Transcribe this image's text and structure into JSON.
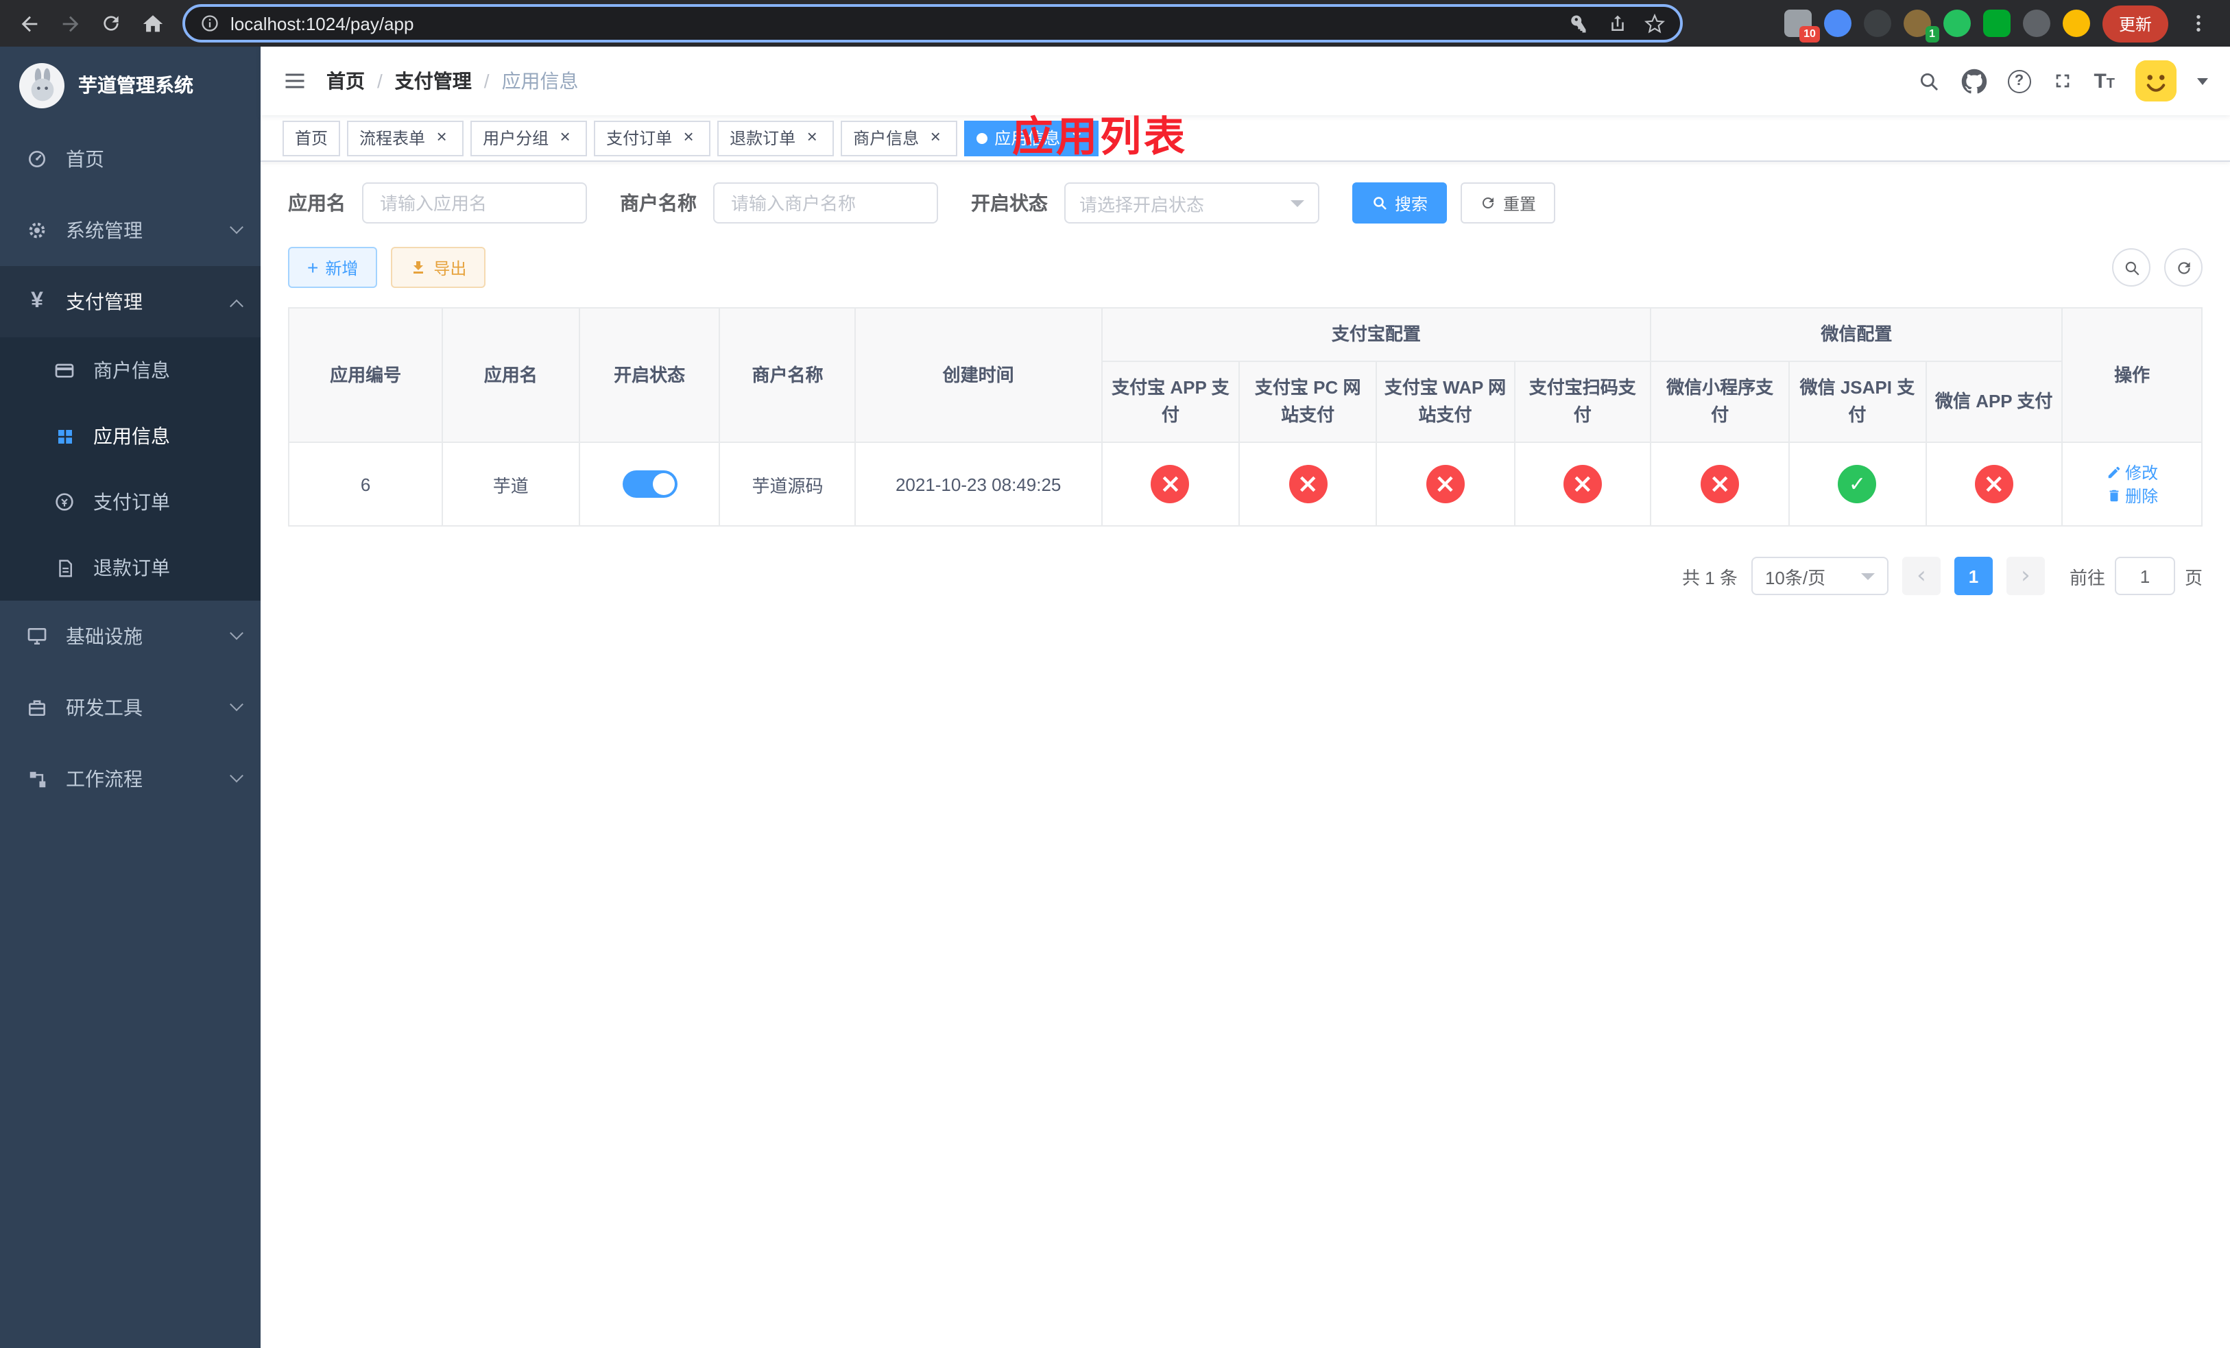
{
  "browser": {
    "url": "localhost:1024/pay/app",
    "update_button": "更新",
    "extensions": [
      {
        "name": "extensions-grid-icon",
        "color": "#9aa0a6",
        "badge": "10",
        "badge_color": "#e8453c"
      },
      {
        "name": "blue-drop-icon",
        "color": "#4e8cf7",
        "badge": ""
      },
      {
        "name": "dark-circle-icon",
        "color": "#3c4043",
        "badge": ""
      },
      {
        "name": "profile-circle-icon",
        "color": "#8a6d3b",
        "badge": "1",
        "badge_color": "#1ea446"
      },
      {
        "name": "green-circle-icon",
        "color": "#25c15f",
        "badge": ""
      },
      {
        "name": "green-square-icon",
        "color": "#00a82d",
        "badge": ""
      },
      {
        "name": "dark-pin-icon",
        "color": "#5f6368",
        "badge": ""
      },
      {
        "name": "smiley-icon",
        "color": "#fbbc04",
        "badge": ""
      }
    ]
  },
  "sidebar": {
    "title": "芋道管理系统",
    "items": [
      {
        "label": "首页"
      },
      {
        "label": "系统管理"
      },
      {
        "label": "支付管理"
      },
      {
        "label": "基础设施"
      },
      {
        "label": "研发工具"
      },
      {
        "label": "工作流程"
      }
    ],
    "pay_children": [
      {
        "label": "商户信息"
      },
      {
        "label": "应用信息"
      },
      {
        "label": "支付订单"
      },
      {
        "label": "退款订单"
      }
    ]
  },
  "navbar": {
    "breadcrumb": [
      "首页",
      "支付管理",
      "应用信息"
    ],
    "overlay_title": "应用列表"
  },
  "tabs": [
    {
      "label": "首页",
      "closable": false,
      "active": false
    },
    {
      "label": "流程表单",
      "closable": true,
      "active": false
    },
    {
      "label": "用户分组",
      "closable": true,
      "active": false
    },
    {
      "label": "支付订单",
      "closable": true,
      "active": false
    },
    {
      "label": "退款订单",
      "closable": true,
      "active": false
    },
    {
      "label": "商户信息",
      "closable": true,
      "active": false
    },
    {
      "label": "应用信息",
      "closable": true,
      "active": true
    }
  ],
  "filters": {
    "app_name": {
      "label": "应用名",
      "placeholder": "请输入应用名"
    },
    "merchant": {
      "label": "商户名称",
      "placeholder": "请输入商户名称"
    },
    "status": {
      "label": "开启状态",
      "placeholder": "请选择开启状态"
    },
    "search_button": "搜索",
    "reset_button": "重置"
  },
  "toolbar": {
    "add_button": "新增",
    "export_button": "导出"
  },
  "table": {
    "groups": {
      "alipay": "支付宝配置",
      "wechat": "微信配置"
    },
    "columns": {
      "app_id": "应用编号",
      "app_name": "应用名",
      "status": "开启状态",
      "merchant": "商户名称",
      "created": "创建时间",
      "alipay_app": "支付宝 APP 支付",
      "alipay_pc": "支付宝 PC 网站支付",
      "alipay_wap": "支付宝 WAP 网站支付",
      "alipay_scan": "支付宝扫码支付",
      "wx_lite": "微信小程序支付",
      "wx_jsapi": "微信 JSAPI 支付",
      "wx_app": "微信 APP 支付",
      "ops": "操作"
    },
    "rows": [
      {
        "app_id": "6",
        "app_name": "芋道",
        "status_on": true,
        "merchant": "芋道源码",
        "created": "2021-10-23 08:49:25",
        "states": {
          "alipay_app": "err",
          "alipay_pc": "err",
          "alipay_wap": "err",
          "alipay_scan": "err",
          "wx_lite": "err",
          "wx_jsapi": "ok",
          "wx_app": "err"
        },
        "actions": {
          "edit": "修改",
          "delete": "删除"
        }
      }
    ]
  },
  "pagination": {
    "total": "共 1 条",
    "page_size": "10条/页",
    "page": "1",
    "goto_label": "前往",
    "goto_value": "1",
    "goto_unit": "页"
  },
  "colors": {
    "accent": "#409eff",
    "success": "#2bc45d",
    "danger": "#f9494b",
    "annotation_red": "#f5222d",
    "sidebar_bg": "#304156",
    "submenu_bg": "#1f2d3d"
  }
}
